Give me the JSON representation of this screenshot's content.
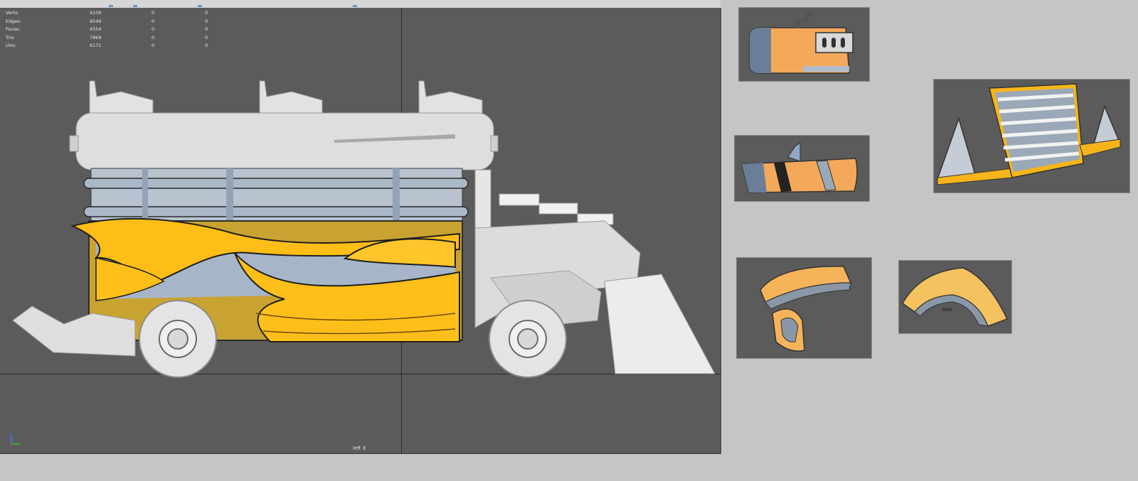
{
  "viewport": {
    "camera_label": "left X",
    "stats": [
      {
        "label": "Verts:",
        "v1": "4100",
        "v2": "0",
        "v3": "0"
      },
      {
        "label": "Edges:",
        "v1": "8549",
        "v2": "0",
        "v3": "0"
      },
      {
        "label": "Faces:",
        "v1": "4554",
        "v2": "0",
        "v3": "0"
      },
      {
        "label": "Tris:",
        "v1": "7969",
        "v2": "0",
        "v3": "0"
      },
      {
        "label": "UVs:",
        "v1": "6171",
        "v2": "0",
        "v3": "0"
      }
    ]
  },
  "colors": {
    "viewport_bg": "#5b5b5b",
    "page_bg": "#c5c5c5",
    "model_gray": "#dcdcdc",
    "flame_yellow": "#ffbf1a",
    "glass_blue": "#9aabbd",
    "part_orange": "#f4a85a"
  },
  "icons": {
    "axis": "axis-gizmo-icon"
  }
}
